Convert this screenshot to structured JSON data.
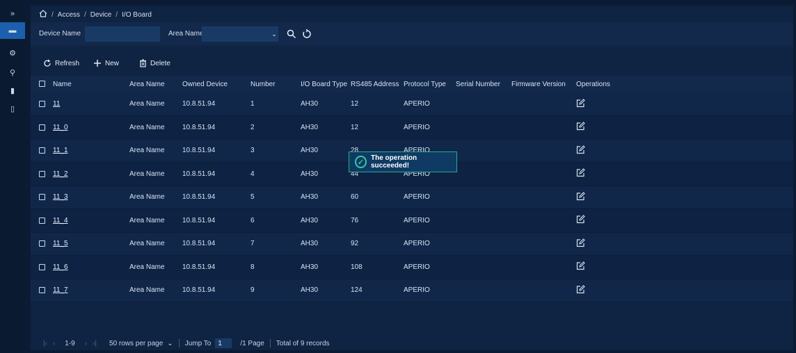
{
  "sidebar": {
    "items": [
      {
        "name": "expand",
        "glyph": "»"
      },
      {
        "name": "device",
        "glyph": "▬"
      },
      {
        "name": "settings",
        "glyph": "⚙"
      },
      {
        "name": "person",
        "glyph": "⚲"
      },
      {
        "name": "document",
        "glyph": "▮"
      },
      {
        "name": "card",
        "glyph": "▯"
      }
    ]
  },
  "breadcrumb": {
    "items": [
      "Access",
      "Device",
      "I/O Board"
    ],
    "separator": "/"
  },
  "filters": {
    "device_name_label": "Device Name",
    "device_name_value": "",
    "area_name_label": "Area Name",
    "area_name_value": ""
  },
  "toolbar": {
    "refresh_label": "Refresh",
    "new_label": "New",
    "delete_label": "Delete"
  },
  "table": {
    "columns": [
      "Name",
      "Area Name",
      "Owned Device",
      "Number",
      "I/O Board Type",
      "RS485 Address",
      "Protocol Type",
      "Serial Number",
      "Firmware Version",
      "Operations"
    ],
    "rows": [
      {
        "name": "11",
        "area": "Area Name",
        "owned": "10.8.51.94",
        "number": "1",
        "type": "AH30",
        "rs485": "12",
        "protocol": "APERIO",
        "serial": "",
        "firmware": ""
      },
      {
        "name": "11_0",
        "area": "Area Name",
        "owned": "10.8.51.94",
        "number": "2",
        "type": "AH30",
        "rs485": "12",
        "protocol": "APERIO",
        "serial": "",
        "firmware": ""
      },
      {
        "name": "11_1",
        "area": "Area Name",
        "owned": "10.8.51.94",
        "number": "3",
        "type": "AH30",
        "rs485": "28",
        "protocol": "APERIO",
        "serial": "",
        "firmware": ""
      },
      {
        "name": "11_2",
        "area": "Area Name",
        "owned": "10.8.51.94",
        "number": "4",
        "type": "AH30",
        "rs485": "44",
        "protocol": "APERIO",
        "serial": "",
        "firmware": ""
      },
      {
        "name": "11_3",
        "area": "Area Name",
        "owned": "10.8.51.94",
        "number": "5",
        "type": "AH30",
        "rs485": "60",
        "protocol": "APERIO",
        "serial": "",
        "firmware": ""
      },
      {
        "name": "11_4",
        "area": "Area Name",
        "owned": "10.8.51.94",
        "number": "6",
        "type": "AH30",
        "rs485": "76",
        "protocol": "APERIO",
        "serial": "",
        "firmware": ""
      },
      {
        "name": "11_5",
        "area": "Area Name",
        "owned": "10.8.51.94",
        "number": "7",
        "type": "AH30",
        "rs485": "92",
        "protocol": "APERIO",
        "serial": "",
        "firmware": ""
      },
      {
        "name": "11_6",
        "area": "Area Name",
        "owned": "10.8.51.94",
        "number": "8",
        "type": "AH30",
        "rs485": "108",
        "protocol": "APERIO",
        "serial": "",
        "firmware": ""
      },
      {
        "name": "11_7",
        "area": "Area Name",
        "owned": "10.8.51.94",
        "number": "9",
        "type": "AH30",
        "rs485": "124",
        "protocol": "APERIO",
        "serial": "",
        "firmware": ""
      }
    ]
  },
  "toast": {
    "message": "The operation succeeded!"
  },
  "pagination": {
    "range": "1-9",
    "rows_per_page": "50 rows per page",
    "jump_label": "Jump To",
    "jump_value": "1",
    "pages": "/1 Page",
    "total": "Total of 9 records"
  },
  "colors": {
    "background": "#0b1b33",
    "panel": "#0f2442",
    "accent": "#1c5fae",
    "success": "#38c9a2"
  }
}
